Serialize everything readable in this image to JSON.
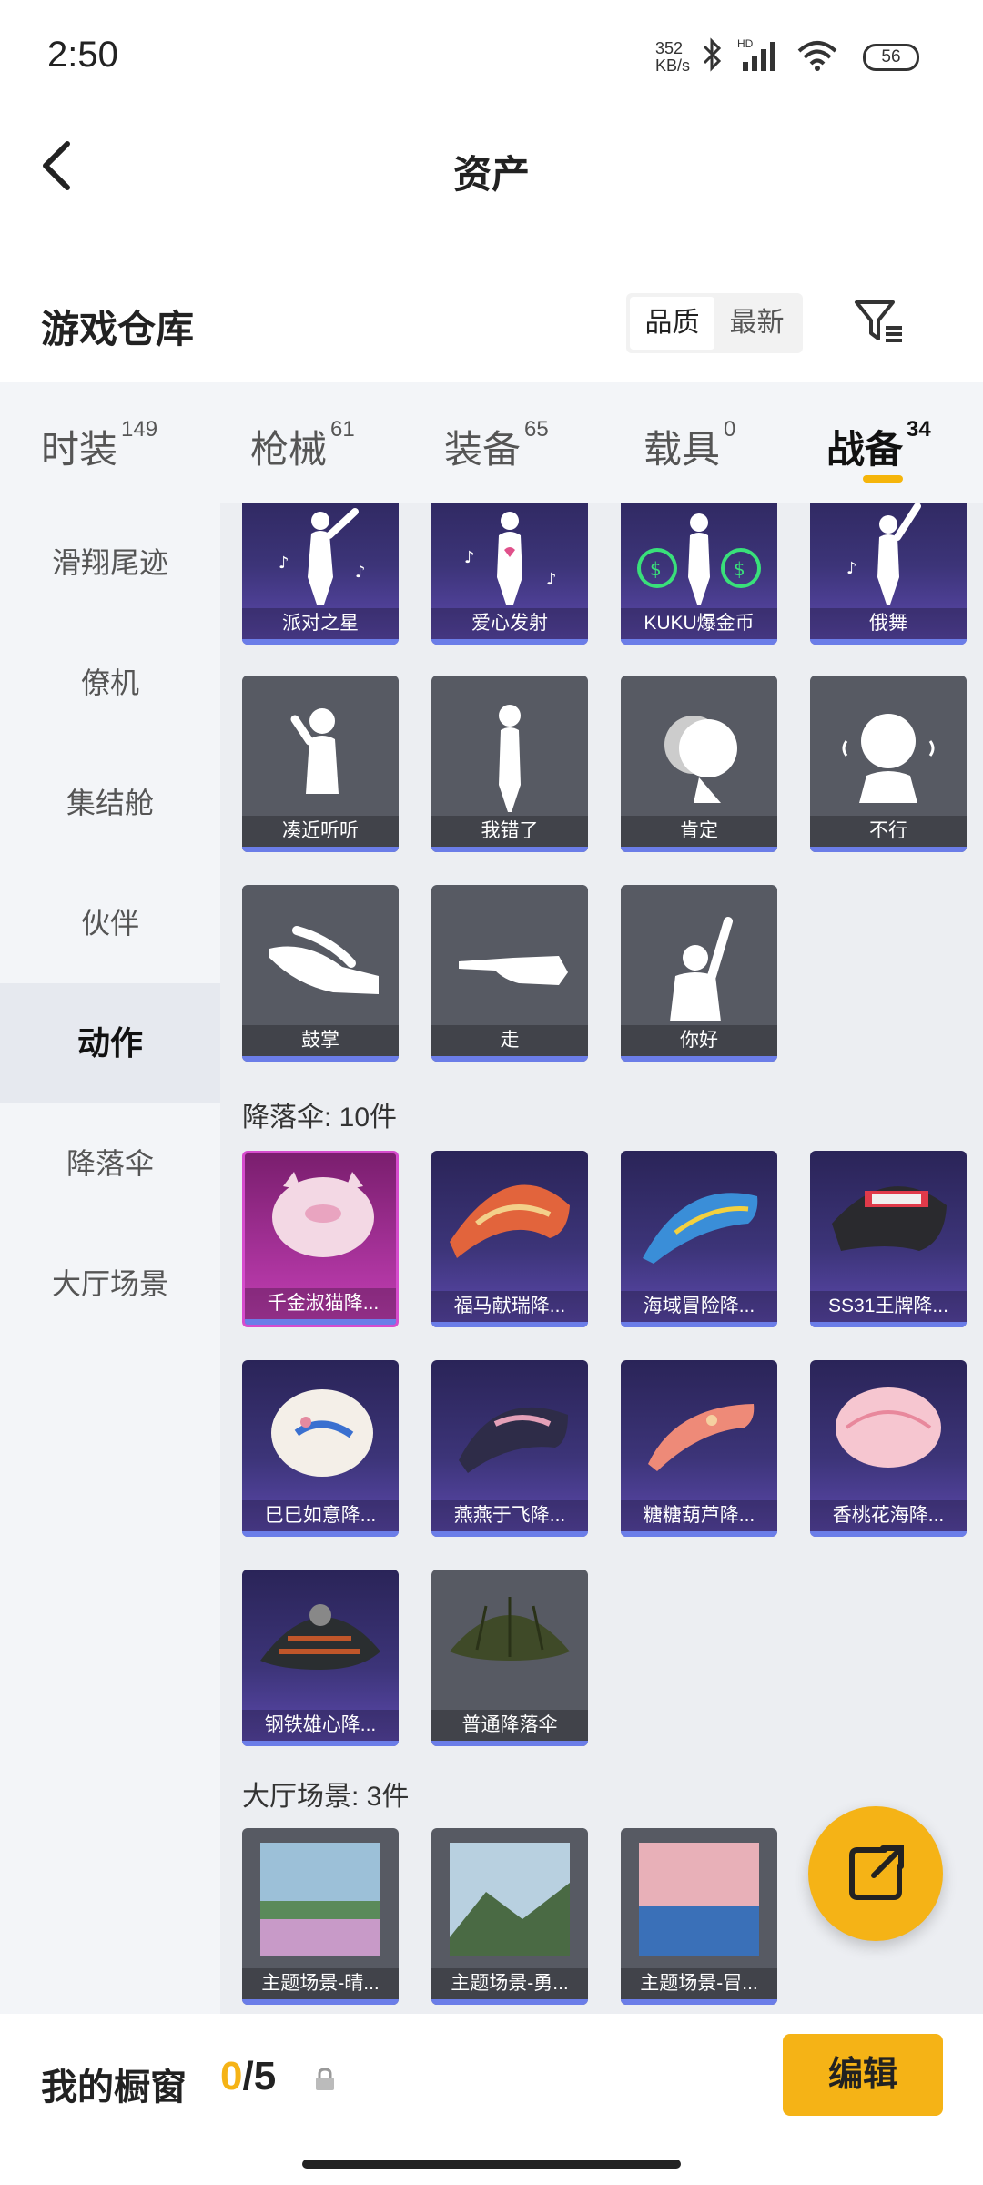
{
  "status": {
    "time": "2:50",
    "speed_top": "352",
    "speed_bottom": "KB/s",
    "battery": "56"
  },
  "header": {
    "title": "资产"
  },
  "warehouse": {
    "title": "游戏仓库",
    "sort_options": [
      "品质",
      "最新"
    ],
    "active_sort": "品质"
  },
  "tabs": [
    {
      "label": "时装",
      "count": "149"
    },
    {
      "label": "枪械",
      "count": "61"
    },
    {
      "label": "装备",
      "count": "65"
    },
    {
      "label": "载具",
      "count": "0"
    },
    {
      "label": "战备",
      "count": "34"
    }
  ],
  "sidebar": [
    "滑翔尾迹",
    "僚机",
    "集结舱",
    "伙伴",
    "动作",
    "降落伞",
    "大厅场景"
  ],
  "sections": {
    "parachute": "降落伞: 10件",
    "lobby": "大厅场景: 3件"
  },
  "actions_row1": [
    "派对之星",
    "爱心发射",
    "KUKU爆金币",
    "俄舞"
  ],
  "actions_row2": [
    "凑近听听",
    "我错了",
    "肯定",
    "不行"
  ],
  "actions_row3": [
    "鼓掌",
    "走",
    "你好"
  ],
  "parachutes_row1": [
    "千金淑猫降...",
    "福马献瑞降...",
    "海域冒险降...",
    "SS31王牌降..."
  ],
  "parachutes_row2": [
    "巳巳如意降...",
    "燕燕于飞降...",
    "糖糖葫芦降...",
    "香桃花海降..."
  ],
  "parachutes_row3": [
    "钢铁雄心降...",
    "普通降落伞"
  ],
  "lobby_scenes": [
    "主题场景-晴...",
    "主题场景-勇...",
    "主题场景-冒..."
  ],
  "bottom": {
    "showcase": "我的橱窗",
    "current": "0",
    "sep_total": "/5",
    "edit": "编辑"
  },
  "colors": {
    "accent": "#f5b316",
    "rarity_bar": "#6b7de8",
    "legendary": "#d64ccd"
  },
  "icons": [
    "back-arrow-icon",
    "filter-icon",
    "share-icon",
    "lock-icon",
    "bluetooth-icon",
    "signal-icon",
    "wifi-icon"
  ]
}
